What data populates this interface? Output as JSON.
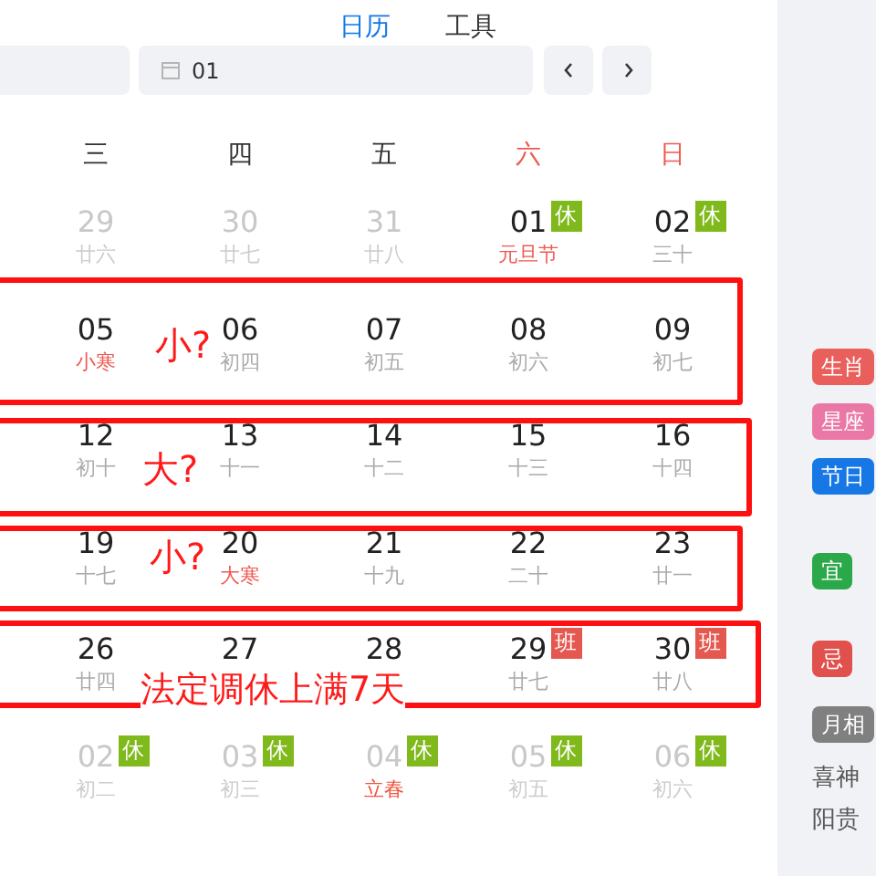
{
  "tabs": [
    {
      "label": "日历",
      "selected": true
    },
    {
      "label": "工具",
      "selected": false
    }
  ],
  "date_picker": {
    "value": "01"
  },
  "weekdays": [
    {
      "label": "三",
      "weekend": false
    },
    {
      "label": "四",
      "weekend": false
    },
    {
      "label": "五",
      "weekend": false
    },
    {
      "label": "六",
      "weekend": true
    },
    {
      "label": "日",
      "weekend": true
    }
  ],
  "weeks": [
    {
      "days": [
        {
          "date": "29",
          "lunar": "廿六",
          "other_month": true
        },
        {
          "date": "30",
          "lunar": "廿七",
          "other_month": true
        },
        {
          "date": "31",
          "lunar": "廿八",
          "other_month": true
        },
        {
          "date": "01",
          "lunar": "元旦节",
          "other_month": false,
          "festival": true,
          "badge": {
            "kind": "rest",
            "label": "休"
          }
        },
        {
          "date": "02",
          "lunar": "三十",
          "other_month": false,
          "badge": {
            "kind": "rest",
            "label": "休"
          }
        }
      ]
    },
    {
      "days": [
        {
          "date": "05",
          "lunar": "小寒",
          "other_month": false,
          "festival": true
        },
        {
          "date": "06",
          "lunar": "初四",
          "other_month": false
        },
        {
          "date": "07",
          "lunar": "初五",
          "other_month": false
        },
        {
          "date": "08",
          "lunar": "初六",
          "other_month": false
        },
        {
          "date": "09",
          "lunar": "初七",
          "other_month": false
        }
      ]
    },
    {
      "days": [
        {
          "date": "12",
          "lunar": "初十",
          "other_month": false
        },
        {
          "date": "13",
          "lunar": "十一",
          "other_month": false
        },
        {
          "date": "14",
          "lunar": "十二",
          "other_month": false
        },
        {
          "date": "15",
          "lunar": "十三",
          "other_month": false
        },
        {
          "date": "16",
          "lunar": "十四",
          "other_month": false
        }
      ]
    },
    {
      "days": [
        {
          "date": "19",
          "lunar": "十七",
          "other_month": false
        },
        {
          "date": "20",
          "lunar": "大寒",
          "other_month": false,
          "festival": true
        },
        {
          "date": "21",
          "lunar": "十九",
          "other_month": false
        },
        {
          "date": "22",
          "lunar": "二十",
          "other_month": false
        },
        {
          "date": "23",
          "lunar": "廿一",
          "other_month": false
        }
      ]
    },
    {
      "days": [
        {
          "date": "26",
          "lunar": "廿四",
          "other_month": false
        },
        {
          "date": "27",
          "other_month": false
        },
        {
          "date": "28",
          "other_month": false
        },
        {
          "date": "29",
          "lunar": "廿七",
          "other_month": false,
          "badge": {
            "kind": "work",
            "label": "班"
          }
        },
        {
          "date": "30",
          "lunar": "廿八",
          "other_month": false,
          "badge": {
            "kind": "work",
            "label": "班"
          }
        }
      ]
    },
    {
      "days": [
        {
          "date": "02",
          "lunar": "初二",
          "other_month": true,
          "badge": {
            "kind": "rest",
            "label": "休"
          }
        },
        {
          "date": "03",
          "lunar": "初三",
          "other_month": true,
          "badge": {
            "kind": "rest",
            "label": "休"
          }
        },
        {
          "date": "04",
          "lunar": "立春",
          "other_month": true,
          "festival": true,
          "badge": {
            "kind": "rest",
            "label": "休"
          }
        },
        {
          "date": "05",
          "lunar": "初五",
          "other_month": true,
          "badge": {
            "kind": "rest",
            "label": "休"
          }
        },
        {
          "date": "06",
          "lunar": "初六",
          "other_month": true,
          "badge": {
            "kind": "rest",
            "label": "休"
          }
        }
      ]
    }
  ],
  "sidebar": {
    "tags": [
      {
        "label": "生肖",
        "color": "#e95f5c"
      },
      {
        "label": "星座",
        "color": "#ea78a6"
      },
      {
        "label": "节日",
        "color": "#1677e5"
      },
      {
        "label": "宜",
        "color": "#2ba84a"
      },
      {
        "label": "忌",
        "color": "#e0504c"
      },
      {
        "label": "月相",
        "color": "#808080"
      }
    ],
    "lines": [
      "喜神",
      "阳贵"
    ]
  },
  "annotations": [
    {
      "text": "小?"
    },
    {
      "text": "大?"
    },
    {
      "text": "小?"
    },
    {
      "text": "法定调休上满7天"
    }
  ]
}
